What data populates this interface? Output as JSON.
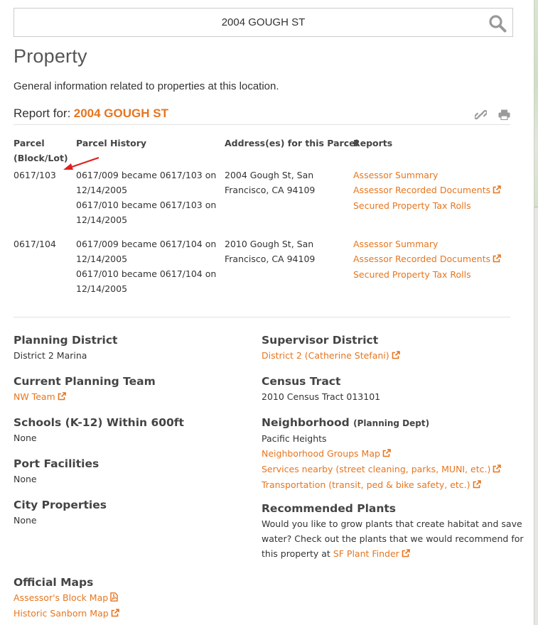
{
  "search": {
    "value": "2004 GOUGH ST",
    "icon": "search-icon"
  },
  "page": {
    "title": "Property",
    "intro": "General information related to properties at this location.",
    "report_label": "Report for:",
    "report_address": "2004 GOUGH ST"
  },
  "colors": {
    "accent": "#e6761f",
    "text": "#333333",
    "heading": "#444444",
    "divider": "#e2e2e2"
  },
  "table": {
    "headers": {
      "parcel_line1": "Parcel",
      "parcel_line2": "(Block/Lot)",
      "history": "Parcel History",
      "address_line1": "Address(es) for this Parcel",
      "reports": "Reports"
    },
    "rows": [
      {
        "parcel": "0617/103",
        "history": [
          {
            "line1": "0617/009 became 0617/103 on",
            "line2": "12/14/2005"
          },
          {
            "line1": "0617/010 became 0617/103 on",
            "line2": "12/14/2005"
          }
        ],
        "address_line1": "2004 Gough St, San",
        "address_line2": "Francisco, CA 94109",
        "reports": [
          "Assessor Summary",
          "Assessor Recorded Documents",
          "Secured Property Tax Rolls"
        ]
      },
      {
        "parcel": "0617/104",
        "history": [
          {
            "line1": "0617/009 became 0617/104 on",
            "line2": "12/14/2005"
          },
          {
            "line1": "0617/010 became 0617/104 on",
            "line2": "12/14/2005"
          }
        ],
        "address_line1": "2010 Gough St, San",
        "address_line2": "Francisco, CA 94109",
        "reports": [
          "Assessor Summary",
          "Assessor Recorded Documents",
          "Secured Property Tax Rolls"
        ]
      }
    ]
  },
  "left": {
    "planning_district": {
      "heading": "Planning District",
      "value": "District 2 Marina"
    },
    "planning_team": {
      "heading": "Current Planning Team",
      "link": "NW Team"
    },
    "schools": {
      "heading": "Schools (K-12) Within 600ft",
      "value": "None"
    },
    "port": {
      "heading": "Port Facilities",
      "value": "None"
    },
    "city_props": {
      "heading": "City Properties",
      "value": "None"
    },
    "official_maps": {
      "heading": "Official Maps",
      "links": [
        "Assessor's Block Map",
        "Historic Sanborn Map"
      ]
    }
  },
  "right": {
    "supervisor": {
      "heading": "Supervisor District",
      "link": "District 2 (Catherine Stefani)"
    },
    "census": {
      "heading": "Census Tract",
      "value": "2010 Census Tract 013101"
    },
    "neighborhood": {
      "heading": "Neighborhood",
      "heading_sub": "(Planning Dept)",
      "value": "Pacific Heights",
      "links": [
        "Neighborhood Groups Map",
        "Services nearby (street cleaning, parks, MUNI, etc.)",
        "Transportation (transit, ped & bike safety, etc.)"
      ]
    },
    "plants": {
      "heading": "Recommended Plants",
      "line1": "Would you like to grow plants that create habitat and save",
      "line2": "water? Check out the plants that we would recommend for",
      "line3_prefix": "this property at",
      "link": "SF Plant Finder"
    }
  }
}
